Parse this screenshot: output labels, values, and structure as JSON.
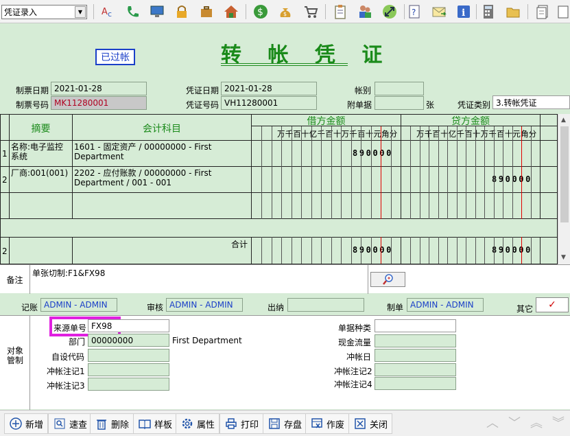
{
  "toolbar": {
    "mode_select_value": "凭证录入",
    "icons": [
      "spellcheck-icon",
      "phone-icon",
      "monitor-icon",
      "lock-icon",
      "briefcase-icon",
      "home-icon",
      "dollar-icon",
      "money-bag-icon",
      "cart-icon",
      "clipboard-icon",
      "users-icon",
      "resize-icon",
      "help-icon",
      "mail-icon",
      "info-icon",
      "calculator-icon",
      "folder-icon",
      "document-icon"
    ]
  },
  "voucher": {
    "title": "转 帐 凭 证",
    "status_stamp": "已过帐",
    "labels": {
      "issue_date": "制票日期",
      "issue_no": "制票号码",
      "voucher_date": "凭证日期",
      "voucher_no": "凭证号码",
      "account_book": "帐别",
      "attachments": "附单据",
      "attachments_unit": "张",
      "voucher_type": "凭证类别"
    },
    "values": {
      "issue_date": "2021-01-28",
      "issue_no": "MK11280001",
      "voucher_date": "2021-01-28",
      "voucher_no": "VH11280001",
      "account_book": "",
      "attachments": "",
      "voucher_type": "3.转帐凭证"
    }
  },
  "grid": {
    "headers": {
      "summary": "摘要",
      "account": "会计科目",
      "debit": "借方金额",
      "credit": "贷方金额",
      "digits": "万千百十亿千百十万千百十元角分"
    },
    "rows": [
      {
        "no": "1",
        "summary": "名称:电子监控系统",
        "account": "1601 - 固定资产 / 00000000 - First Department",
        "debit": "890000",
        "credit": ""
      },
      {
        "no": "2",
        "summary": "厂商:001(001)",
        "account": "2202 - 应付账款 / 00000000 - First Department / 001 - 001",
        "debit": "",
        "credit": "890000"
      },
      {
        "no": "",
        "summary": "",
        "account": "",
        "debit": "",
        "credit": ""
      }
    ],
    "total": {
      "no": "2",
      "label": "合计",
      "debit": "890000",
      "credit": "890000"
    }
  },
  "remark": {
    "label": "备注",
    "text": "单张切制:F1&FX98"
  },
  "signoff": {
    "bookkeeper_label": "记账",
    "bookkeeper": "ADMIN - ADMIN",
    "review_label": "审核",
    "review": "ADMIN - ADMIN",
    "cashier_label": "出纳",
    "cashier": "",
    "maker_label": "制单",
    "maker": "ADMIN - ADMIN",
    "other_label": "其它"
  },
  "object": {
    "side_label": "对象管制",
    "source_no_label": "来源单号",
    "source_no": "FX98",
    "dept_label": "部门",
    "dept_code": "00000000",
    "dept_name": "First Department",
    "custom_code_label": "自设代码",
    "custom_code": "",
    "note1_label": "冲帐注记1",
    "note1": "",
    "note3_label": "冲帐注记3",
    "note3": "",
    "doc_type_label": "单据种类",
    "doc_type": "",
    "cash_flow_label": "现金流量",
    "cash_flow": "",
    "offset_date_label": "冲帐日",
    "offset_date": "",
    "note2_label": "冲帐注记2",
    "note2": "",
    "note4_label": "冲帐注记4",
    "note4": ""
  },
  "actions": [
    {
      "name": "add",
      "label": "新增",
      "icon": "plus-circle-icon"
    },
    {
      "name": "quick-search",
      "label": "速查",
      "icon": "search-icon"
    },
    {
      "name": "delete",
      "label": "删除",
      "icon": "trash-icon"
    },
    {
      "name": "template",
      "label": "样板",
      "icon": "book-icon"
    },
    {
      "name": "properties",
      "label": "属性",
      "icon": "gear-icon"
    },
    {
      "name": "print",
      "label": "打印",
      "icon": "printer-icon"
    },
    {
      "name": "save",
      "label": "存盘",
      "icon": "disk-icon"
    },
    {
      "name": "void",
      "label": "作废",
      "icon": "void-icon"
    },
    {
      "name": "close",
      "label": "关闭",
      "icon": "close-icon"
    }
  ],
  "colors": {
    "background": "#d6ecd6",
    "title": "#1a8a1a",
    "stamp": "#1a3fc8",
    "highlight": "#e020e0"
  }
}
